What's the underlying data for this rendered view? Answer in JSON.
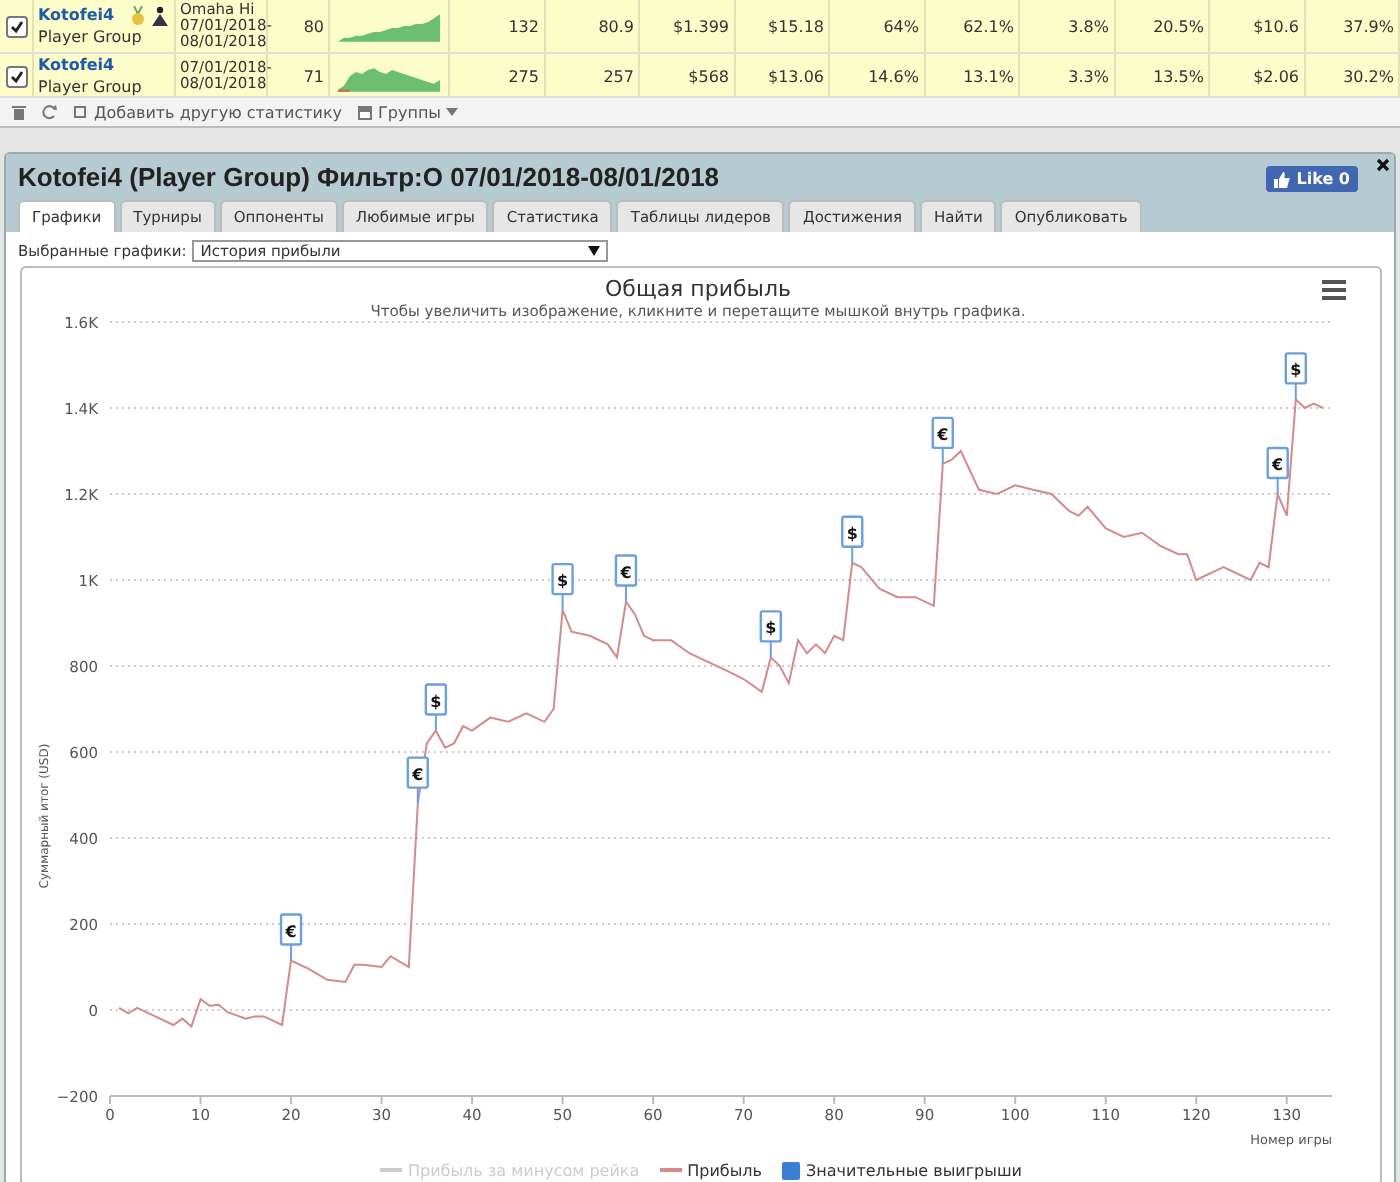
{
  "players_table": {
    "rows": [
      {
        "checked": true,
        "name": "Kotofei4",
        "group": "Player Group",
        "has_badges": true,
        "game_lines": [
          "Omaha Hi",
          "07/01/2018-",
          "08/01/2018"
        ],
        "games": "80",
        "stats": [
          "132",
          "80.9",
          "$1.399",
          "$15.18",
          "64%",
          "62.1%",
          "3.8%",
          "20.5%",
          "$10.6",
          "37.9%"
        ]
      },
      {
        "checked": true,
        "name": "Kotofei4",
        "group": "Player Group",
        "has_badges": false,
        "game_lines": [
          "07/01/2018-",
          "08/01/2018"
        ],
        "games": "71",
        "stats": [
          "275",
          "257",
          "$568",
          "$13.06",
          "14.6%",
          "13.1%",
          "3.3%",
          "13.5%",
          "$2.06",
          "30.2%"
        ]
      }
    ]
  },
  "toolbar": {
    "add_stat": "Добавить другую статистику",
    "groups": "Группы"
  },
  "panel": {
    "title": "Kotofei4 (Player Group) Фильтр:О 07/01/2018-08/01/2018",
    "like_button": {
      "label": "Like",
      "count": "0"
    },
    "tabs": [
      {
        "label": "Графики",
        "selected": true
      },
      {
        "label": "Турниры",
        "selected": false
      },
      {
        "label": "Оппоненты",
        "selected": false
      },
      {
        "label": "Любимые игры",
        "selected": false
      },
      {
        "label": "Статистика",
        "selected": false
      },
      {
        "label": "Таблицы лидеров",
        "selected": false
      },
      {
        "label": "Достижения",
        "selected": false
      },
      {
        "label": "Найти",
        "selected": false
      },
      {
        "label": "Опубликовать",
        "selected": false
      }
    ],
    "chart_selector": {
      "label": "Выбранные графики:",
      "value": "История прибыли"
    },
    "chart": {
      "subtitle": "Чтобы увеличить изображение, кликните и перетащите мышкой внутрь графика.",
      "legend": [
        {
          "label": "Прибыль за минусом рейка",
          "kind": "line",
          "color": "#cccccc",
          "hidden": true
        },
        {
          "kind": "series",
          "hidden": false
        },
        {
          "label": "Значительные выигрыши",
          "kind": "square",
          "color": "#3a7fd5",
          "hidden": false
        }
      ],
      "chart_data": {
        "type": "line",
        "grid": true,
        "title": "Общая прибыль",
        "xlabel": "Номер игры",
        "ylabel": "Суммарный итог (USD)",
        "xlim": [
          0,
          135
        ],
        "ylim": [
          -200,
          1600
        ],
        "xticks": [
          0,
          10,
          20,
          30,
          40,
          50,
          60,
          70,
          80,
          90,
          100,
          110,
          120,
          130
        ],
        "yticks": [
          {
            "value": -200,
            "label": "−200"
          },
          {
            "value": 0,
            "label": "0"
          },
          {
            "value": 200,
            "label": "200"
          },
          {
            "value": 400,
            "label": "400"
          },
          {
            "value": 600,
            "label": "600"
          },
          {
            "value": 800,
            "label": "800"
          },
          {
            "value": 1000,
            "label": "1K"
          },
          {
            "value": 1200,
            "label": "1.2K"
          },
          {
            "value": 1400,
            "label": "1.4K"
          },
          {
            "value": 1600,
            "label": "1.6K"
          }
        ],
        "x": [
          1,
          2,
          3,
          5,
          7,
          8,
          9,
          10,
          11,
          12,
          13,
          15,
          16,
          17,
          19,
          20,
          22,
          24,
          26,
          27,
          28,
          30,
          31,
          33,
          34,
          35,
          36,
          37,
          38,
          39,
          40,
          42,
          44,
          46,
          48,
          49,
          50,
          51,
          53,
          55,
          56,
          57,
          58,
          59,
          60,
          62,
          64,
          66,
          68,
          70,
          72,
          73,
          74,
          75,
          76,
          77,
          78,
          79,
          80,
          81,
          82,
          83,
          85,
          87,
          89,
          91,
          92,
          93,
          94,
          96,
          98,
          100,
          102,
          104,
          106,
          107,
          108,
          110,
          112,
          114,
          116,
          118,
          119,
          120,
          122,
          123,
          126,
          127,
          128,
          129,
          130,
          131,
          132,
          133,
          134
        ],
        "series": [
          {
            "name": "Прибыль",
            "color": "#d48a8a",
            "values": [
              5,
              -8,
              5,
              -15,
              -35,
              -20,
              -38,
              25,
              10,
              12,
              -5,
              -20,
              -15,
              -15,
              -35,
              115,
              95,
              70,
              65,
              105,
              105,
              100,
              125,
              100,
              480,
              620,
              650,
              610,
              620,
              660,
              650,
              680,
              670,
              690,
              670,
              700,
              930,
              880,
              870,
              850,
              820,
              950,
              920,
              870,
              860,
              860,
              830,
              810,
              790,
              770,
              740,
              820,
              800,
              760,
              860,
              830,
              850,
              830,
              870,
              860,
              1040,
              1030,
              980,
              960,
              960,
              940,
              1270,
              1280,
              1300,
              1210,
              1200,
              1220,
              1210,
              1200,
              1160,
              1150,
              1170,
              1120,
              1100,
              1110,
              1080,
              1060,
              1060,
              1000,
              1020,
              1030,
              1000,
              1040,
              1030,
              1200,
              1150,
              1420,
              1400,
              1410,
              1400
            ]
          }
        ],
        "annotations": [
          {
            "x": 20,
            "text": "€"
          },
          {
            "x": 34,
            "text": "€"
          },
          {
            "x": 36,
            "text": "$"
          },
          {
            "x": 50,
            "text": "$"
          },
          {
            "x": 57,
            "text": "€"
          },
          {
            "x": 73,
            "text": "$"
          },
          {
            "x": 82,
            "text": "$"
          },
          {
            "x": 92,
            "text": "€"
          },
          {
            "x": 129,
            "text": "€"
          },
          {
            "x": 131,
            "text": "$"
          }
        ]
      }
    }
  }
}
